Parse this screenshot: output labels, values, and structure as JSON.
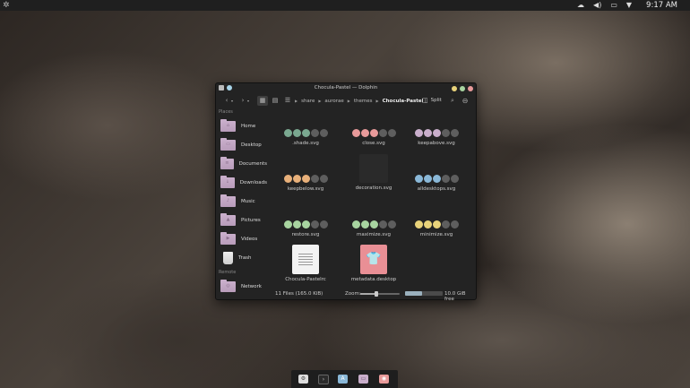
{
  "panel": {
    "launcher_icon": "plasma-launcher-icon",
    "tray": {
      "clock": "9:17 AM"
    }
  },
  "window": {
    "title": "Chocula-Pastel — Dolphin",
    "button_colors": {
      "minimize": "#e8d27a",
      "maximize": "#a8d4a0",
      "close": "#e89a9a"
    },
    "toolbar": {
      "back": "‹",
      "forward": "›",
      "breadcrumbs": [
        "share",
        "aurorae",
        "themes",
        "Chocula-Pastel"
      ],
      "split_label": "Split"
    },
    "sidebar": {
      "places_label": "Places",
      "remote_label": "Remote",
      "items": [
        {
          "label": "Home"
        },
        {
          "label": "Desktop"
        },
        {
          "label": "Documents"
        },
        {
          "label": "Downloads"
        },
        {
          "label": "Music"
        },
        {
          "label": "Pictures"
        },
        {
          "label": "Videos"
        },
        {
          "label": "Trash"
        }
      ],
      "remote_items": [
        {
          "label": "Network"
        }
      ]
    },
    "files": [
      {
        "name": ".shade.svg",
        "colors": [
          "#7aa890",
          "#7aa890",
          "#7aa890",
          "#5e5e5e",
          "#5e5e5e"
        ]
      },
      {
        "name": "close.svg",
        "colors": [
          "#e89a9a",
          "#e89a9a",
          "#e89a9a",
          "#5e5e5e",
          "#5e5e5e"
        ]
      },
      {
        "name": "keepabove.svg",
        "colors": [
          "#c9aecb",
          "#c9aecb",
          "#c9aecb",
          "#5e5e5e",
          "#5e5e5e"
        ]
      },
      {
        "name": "keepbelow.svg",
        "colors": [
          "#e8b07a",
          "#e8b07a",
          "#e8b07a",
          "#5e5e5e",
          "#5e5e5e"
        ]
      },
      {
        "name": "decoration.svg",
        "colors": []
      },
      {
        "name": "alldesktops.svg",
        "colors": [
          "#8ab8d8",
          "#8ab8d8",
          "#8ab8d8",
          "#5e5e5e",
          "#5e5e5e"
        ]
      },
      {
        "name": "restore.svg",
        "colors": [
          "#a8d4a0",
          "#a8d4a0",
          "#a8d4a0",
          "#5e5e5e",
          "#5e5e5e"
        ]
      },
      {
        "name": "maximize.svg",
        "colors": [
          "#a8d4a0",
          "#a8d4a0",
          "#a8d4a0",
          "#5e5e5e",
          "#5e5e5e"
        ]
      },
      {
        "name": "minimize.svg",
        "colors": [
          "#e8d27a",
          "#e8d27a",
          "#e8d27a",
          "#5e5e5e",
          "#5e5e5e"
        ]
      },
      {
        "name": "Chocula-Pastelrc",
        "colors": []
      },
      {
        "name": "metadata.desktop",
        "colors": []
      }
    ],
    "status": {
      "file_count": "11 Files (165.0 KiB)",
      "zoom_label": "Zoom:",
      "zoom_level_fraction": 0.42,
      "space_used_fraction": 0.46,
      "free_space": "10.0 GiB free"
    }
  },
  "dock": {
    "apps": [
      "settings-app-icon",
      "terminal-app-icon",
      "app-store-icon",
      "file-manager-icon",
      "browser-icon"
    ]
  }
}
